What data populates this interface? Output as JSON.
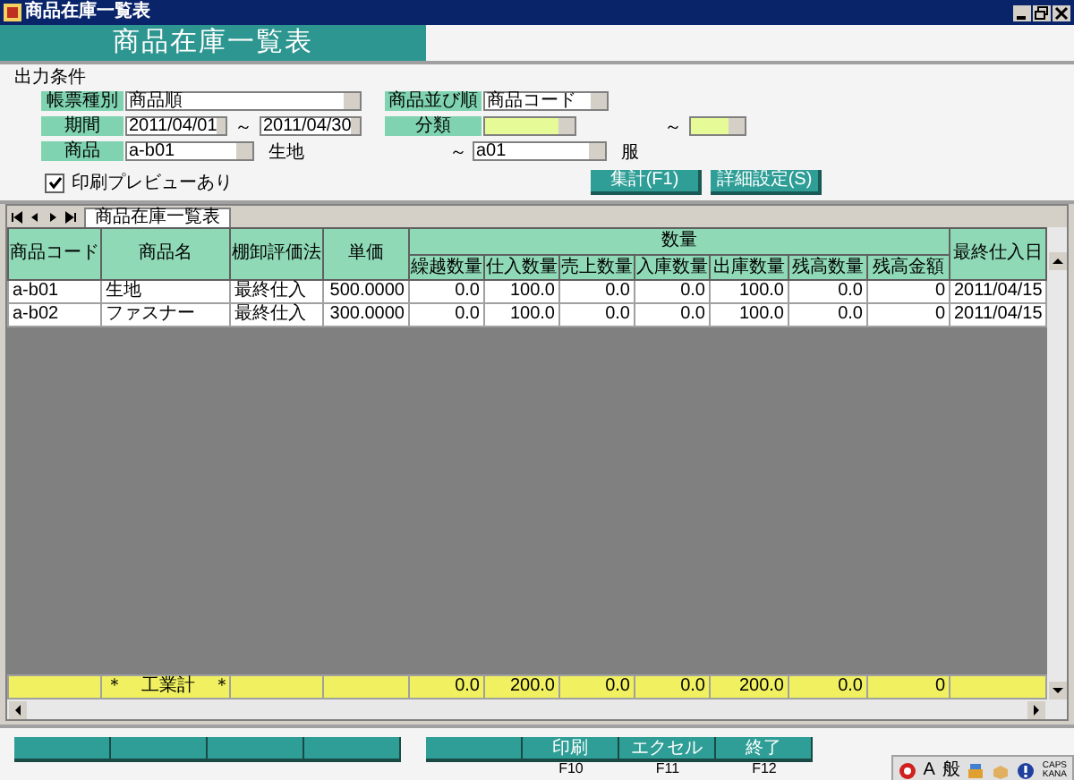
{
  "window": {
    "title": "商品在庫一覧表"
  },
  "header": {
    "title": "商品在庫一覧表"
  },
  "conditions": {
    "heading": "出力条件",
    "report_type": {
      "label": "帳票種別",
      "value": "商品順"
    },
    "sort_order": {
      "label": "商品並び順",
      "value": "商品コード"
    },
    "period": {
      "label": "期間",
      "from": "2011/04/01",
      "separator": "～",
      "to": "2011/04/30"
    },
    "category": {
      "label": "分類",
      "separator": "～",
      "disabled": true
    },
    "product": {
      "label": "商品",
      "from": "a-b01",
      "from_name": "生地",
      "separator": "～",
      "to": "a01",
      "to_name": "服"
    },
    "print_preview": {
      "label": "印刷プレビューあり",
      "checked": true
    },
    "buttons": [
      "集計(F1)",
      "詳細設定(S)"
    ]
  },
  "sheet_tab": {
    "label": "商品在庫一覧表",
    "selected": true
  },
  "table": {
    "group_header": {
      "label": "数量"
    },
    "columns": [
      {
        "label": "商品コード",
        "grouped": false
      },
      {
        "label": "商品名",
        "grouped": false
      },
      {
        "label": "棚卸評価法",
        "grouped": false
      },
      {
        "label": "単価",
        "grouped": false
      },
      {
        "label": "繰越数量",
        "grouped": true
      },
      {
        "label": "仕入数量",
        "grouped": true
      },
      {
        "label": "売上数量",
        "grouped": true
      },
      {
        "label": "入庫数量",
        "grouped": true
      },
      {
        "label": "出庫数量",
        "grouped": true
      },
      {
        "label": "残高数量",
        "grouped": true
      },
      {
        "label": "残高金額",
        "grouped": true
      },
      {
        "label": "最終仕入日",
        "grouped": false
      }
    ],
    "rows": [
      [
        "a-b01",
        "生地",
        "最終仕入",
        "500.0000",
        "0.0",
        "100.0",
        "0.0",
        "0.0",
        "100.0",
        "0.0",
        "0",
        "2011/04/15"
      ],
      [
        "a-b02",
        "ファスナー",
        "最終仕入",
        "300.0000",
        "0.0",
        "100.0",
        "0.0",
        "0.0",
        "100.0",
        "0.0",
        "0",
        "2011/04/15"
      ]
    ],
    "total": {
      "label": "＊　工業計　＊",
      "values": [
        "0.0",
        "200.0",
        "0.0",
        "0.0",
        "200.0",
        "0.0",
        "0"
      ]
    }
  },
  "function_keys": [
    {
      "kind": "blank"
    },
    {
      "kind": "blank"
    },
    {
      "kind": "blank"
    },
    {
      "kind": "blank"
    },
    {
      "kind": "gap"
    },
    {
      "kind": "blank"
    },
    {
      "kind": "labeled",
      "label": "印刷",
      "key": "F10"
    },
    {
      "kind": "labeled",
      "label": "エクセル",
      "key": "F11"
    },
    {
      "kind": "labeled",
      "label": "終了",
      "key": "F12"
    }
  ],
  "tray": {
    "ime_mode": "A",
    "ime_type": "般",
    "caps": "CAPS",
    "kana": "KANA"
  }
}
